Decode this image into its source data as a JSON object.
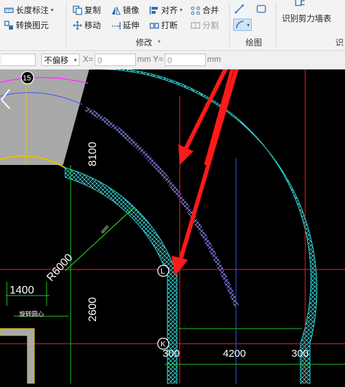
{
  "ribbon": {
    "length_dim": "长度标注",
    "convert": "转换图元",
    "copy": "复制",
    "mirror": "镜像",
    "align": "对齐",
    "merge": "合并",
    "move": "移动",
    "extend": "延伸",
    "break": "打断",
    "split": "分割",
    "group_modify": "修改",
    "group_draw": "绘图",
    "identify_wall": "识别剪力墙表",
    "identify_short": "识"
  },
  "options": {
    "offset_mode": "不偏移",
    "x_label": "X=",
    "x_value": "0",
    "mm1": "mm",
    "y_label": "Y=",
    "y_value": "0",
    "mm2": "mm"
  },
  "drawing": {
    "axis_15": "15",
    "axis_L": "L",
    "axis_K": "K",
    "dim_8100": "8100",
    "dim_2600": "2600",
    "dim_1400": "1400",
    "dim_R6000": "R6000",
    "dim_6000_small": "6000",
    "dim_300_left": "300",
    "dim_4200": "4200",
    "dim_300_right": "300",
    "note": "旋转圆心"
  },
  "colors": {
    "wall_cyan": "#33d6d6",
    "axis_red": "#ff2222",
    "dim_green": "#22cc22",
    "annotation_arrow": "#ff1a1a",
    "beam_blue": "#3355ff",
    "slab_gray": "#aaaaaa",
    "magenta_line": "#ff33ff",
    "yellow_line": "#e6c200"
  }
}
